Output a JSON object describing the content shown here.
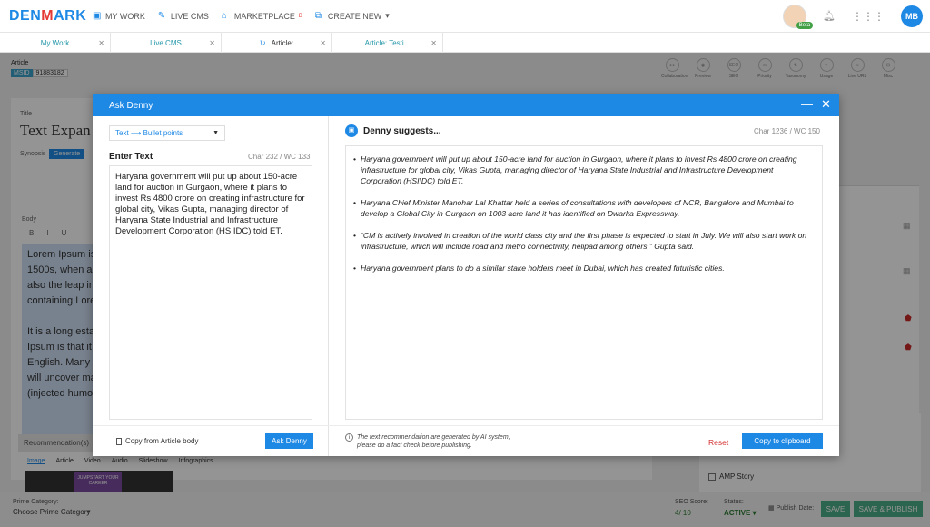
{
  "topnav": {
    "logo": "DENMARK",
    "items": [
      {
        "icon": "my-work-icon",
        "label": "MY WORK"
      },
      {
        "icon": "wrench-icon",
        "label": "LIVE CMS"
      },
      {
        "icon": "marketplace-icon",
        "label": "MARKETPLACE",
        "badge": "β"
      },
      {
        "icon": "create-icon",
        "label": "CREATE NEW"
      }
    ],
    "beta_label": "Beta",
    "user_initials": "MB"
  },
  "tabs": [
    {
      "label": "My Work"
    },
    {
      "label": "Live CMS"
    },
    {
      "label": "Article:"
    },
    {
      "label": "Article: Testi..."
    }
  ],
  "page": {
    "article_label": "Article",
    "msid_key": "MSID",
    "msid_value": "91883182",
    "title_label": "Title",
    "title_value": "Text Expan",
    "synopsis_label": "Synopsis",
    "generate_label": "Generate",
    "body_label": "Body",
    "format_buttons": [
      "B",
      "I",
      "U"
    ],
    "body_text": "Lorem Ipsum is s\n1500s, when an u\nalso the leap into\ncontaining Loren\n\nIt is a long establ\nIpsum is that it h\nEnglish. Many de\nwill uncover man\n(injected humour",
    "recommendation_label": "Recommendation(s)",
    "reco_tabs": [
      "Image",
      "Article",
      "Video",
      "Audio",
      "Slideshow",
      "Infographics"
    ],
    "reco_thumb_text": "JUMPSTART YOUR CAREER",
    "toolbar": [
      "Collaboration",
      "Preview",
      "SEO",
      "Priority",
      "Taxonomy",
      "Usage",
      "Live URL",
      "Misc"
    ],
    "amp_story": "AMP Story"
  },
  "bottombar": {
    "prime_category_label": "Prime Category:",
    "prime_category_value": "Choose Prime Category",
    "seo_label": "SEO Score:",
    "seo_value": "4/ 10",
    "status_label": "Status:",
    "status_value": "ACTIVE",
    "publish_date_label": "Publish Date:",
    "save": "SAVE",
    "save_publish": "SAVE & PUBLISH"
  },
  "modal": {
    "title": "Ask Denny",
    "mode_select": "Text ⟶ Bullet points",
    "enter_text_label": "Enter Text",
    "input_stats": "Char 232 / WC 133",
    "input_text": "Haryana government will put up about 150-acre land for auction in Gurgaon, where it plans to invest Rs 4800 crore on creating infrastructure for global city, Vikas Gupta, managing director of Haryana State Industrial and Infrastructure Development Corporation (HSIIDC) told ET.",
    "suggest_title": "Denny suggests...",
    "suggest_stats": "Char 1236 / WC 150",
    "bullets": [
      "Haryana government will put up about 150-acre land for auction in Gurgaon, where it plans to invest Rs 4800 crore on creating infrastructure for global city, Vikas Gupta, managing director of Haryana State Industrial and Infrastructure Development Corporation (HSIIDC) told ET.",
      "Haryana Chief Minister Manohar Lal Khattar held a series of consultations with developers of NCR, Bangalore and Mumbai to develop a Global City in Gurgaon on 1003 acre land it has identified on Dwarka Expressway.",
      "“CM is actively involved in creation of the world class city and the first phase is expected to start in July. We will also start work on infrastructure, which will include road and metro connectivity, helipad among others,” Gupta said.",
      "Haryana government plans to do a similar stake holders meet in Dubai, which has created futuristic cities."
    ],
    "copy_from_article": "Copy from Article body",
    "ask_button": "Ask Denny",
    "ai_note": "The text recommendation are generated by AI system, please do a fact check before publishing.",
    "reset": "Reset",
    "copy_button": "Copy to clipboard"
  }
}
